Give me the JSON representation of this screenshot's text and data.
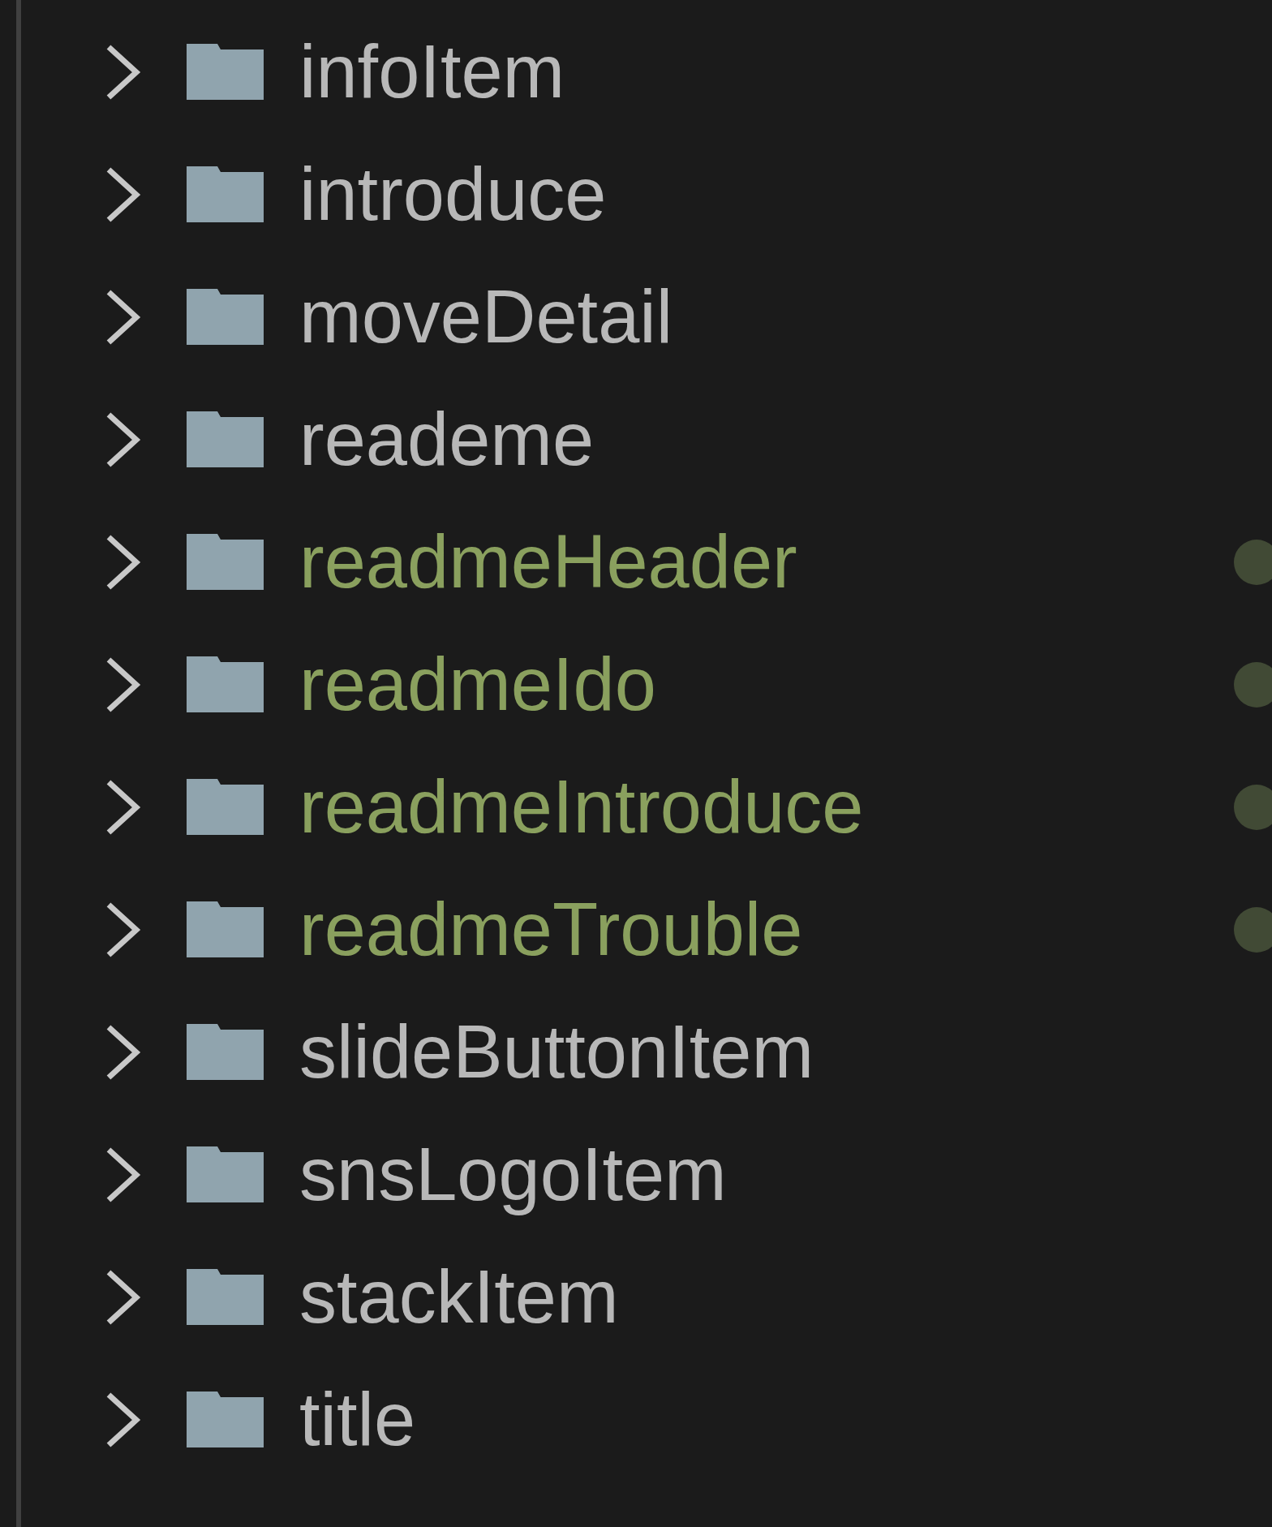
{
  "explorer": {
    "items": [
      {
        "label": "infoItem",
        "modified": false
      },
      {
        "label": "introduce",
        "modified": false
      },
      {
        "label": "moveDetail",
        "modified": false
      },
      {
        "label": "reademe",
        "modified": false
      },
      {
        "label": "readmeHeader",
        "modified": true
      },
      {
        "label": "readmeIdo",
        "modified": true
      },
      {
        "label": "readmeIntroduce",
        "modified": true
      },
      {
        "label": "readmeTrouble",
        "modified": true
      },
      {
        "label": "slideButtonItem",
        "modified": false
      },
      {
        "label": "snsLogoItem",
        "modified": false
      },
      {
        "label": "stackItem",
        "modified": false
      },
      {
        "label": "title",
        "modified": false
      }
    ]
  }
}
